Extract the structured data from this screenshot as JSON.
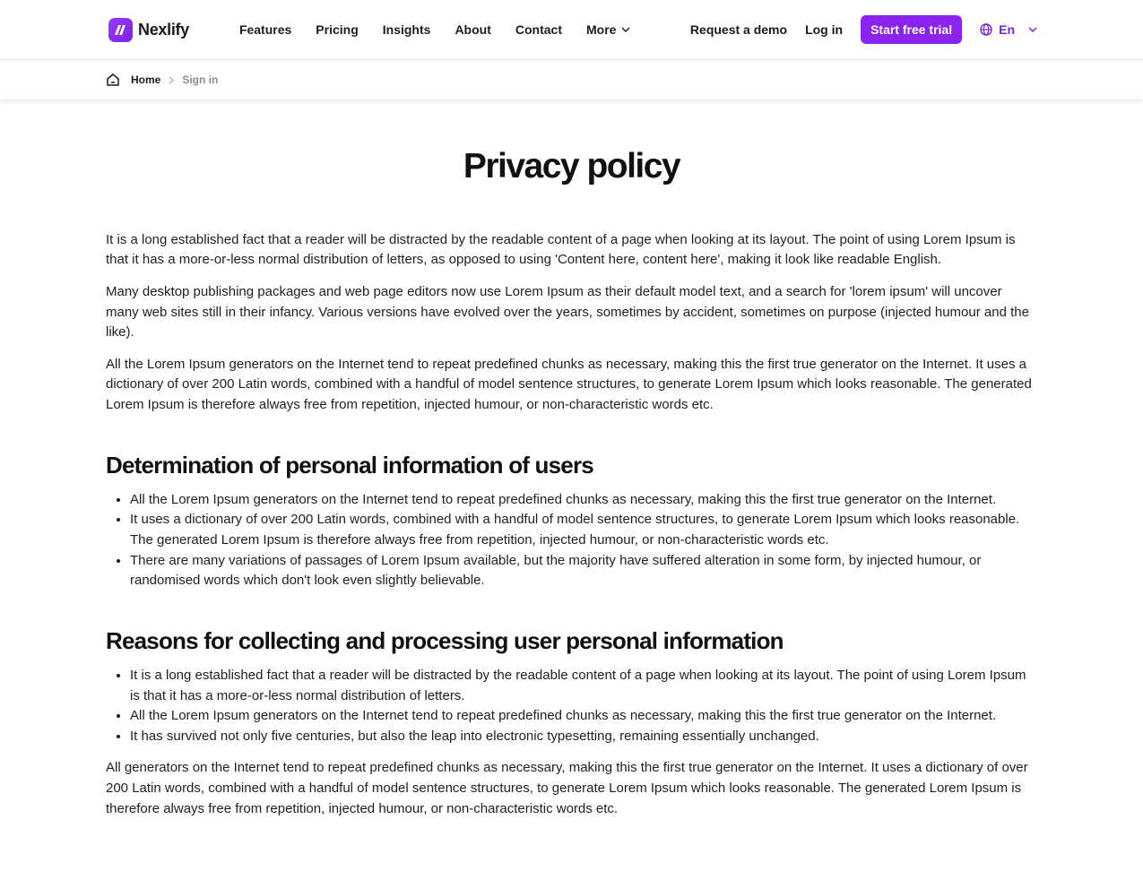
{
  "brand": {
    "name": "Nexlify",
    "accent": "#8a22f0"
  },
  "nav": {
    "items": [
      "Features",
      "Pricing",
      "Insights",
      "About",
      "Contact"
    ],
    "more_label": "More",
    "request_demo": "Request a demo",
    "log_in": "Log in",
    "start_trial": "Start free trial",
    "language": "En"
  },
  "breadcrumb": {
    "home": "Home",
    "current": "Sign in"
  },
  "page": {
    "title": "Privacy policy",
    "intro": [
      "It is a long established fact that a reader will be distracted by the readable content of a page when looking at its layout. The point of using Lorem Ipsum is that it has a more-or-less normal distribution of letters, as opposed to using 'Content here, content here', making it look like readable English.",
      "Many desktop publishing packages and web page editors now use Lorem Ipsum as their default model text, and a search for 'lorem ipsum' will uncover many web sites still in their infancy. Various versions have evolved over the years, sometimes by accident, sometimes on purpose (injected humour and the like).",
      "All the Lorem Ipsum generators on the Internet tend to repeat predefined chunks as necessary, making this the first true generator on the Internet. It uses a dictionary of over 200 Latin words, combined with a handful of model sentence structures, to generate Lorem Ipsum which looks reasonable. The generated Lorem Ipsum is therefore always free from repetition, injected humour, or non-characteristic words etc."
    ],
    "sections": [
      {
        "heading": "Determination of personal information of users",
        "bullets": [
          "All the Lorem Ipsum generators on the Internet tend to repeat predefined chunks as necessary, making this the first true generator on the Internet.",
          "It uses a dictionary of over 200 Latin words, combined with a handful of model sentence structures, to generate Lorem Ipsum which looks reasonable. The generated Lorem Ipsum is therefore always free from repetition, injected humour, or non-characteristic words etc.",
          "There are many variations of passages of Lorem Ipsum available, but the majority have suffered alteration in some form, by injected humour, or randomised words which don't look even slightly believable."
        ]
      },
      {
        "heading": "Reasons for collecting and processing user personal information",
        "bullets": [
          "It is a long established fact that a reader will be distracted by the readable content of a page when looking at its layout. The point of using Lorem Ipsum is that it has a more-or-less normal distribution of letters.",
          "All the Lorem Ipsum generators on the Internet tend to repeat predefined chunks as necessary, making this the first true generator on the Internet.",
          "It has survived not only five centuries, but also the leap into electronic typesetting, remaining essentially unchanged."
        ]
      }
    ],
    "closing": "All generators on the Internet tend to repeat predefined chunks as necessary, making this the first true generator on the Internet. It uses a dictionary of over 200 Latin words, combined with a handful of model sentence structures, to generate Lorem Ipsum which looks reasonable. The generated Lorem Ipsum is therefore always free from repetition, injected humour, or non-characteristic words etc."
  }
}
